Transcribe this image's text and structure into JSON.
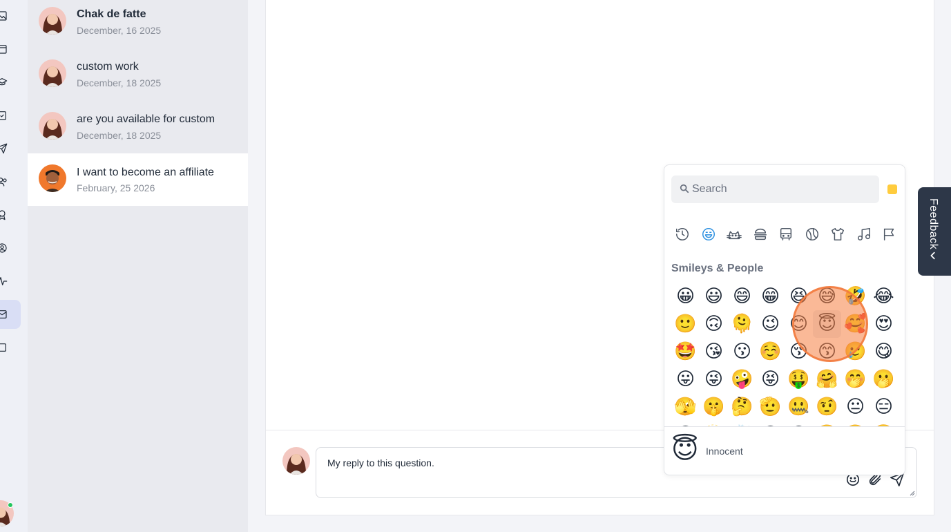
{
  "rail": {
    "icons": [
      "image-icon",
      "calendar-icon",
      "graduation-cap-icon",
      "clipboard-icon",
      "send-icon",
      "users-icon",
      "award-icon",
      "user-circle-icon",
      "activity-icon",
      "inbox-icon",
      "square-icon"
    ],
    "active_icon": "inbox-icon"
  },
  "conversations": [
    {
      "title": "Chak de fatte",
      "date": "December, 16 2025",
      "avatar": "woman-avatar",
      "unread": true,
      "selected": false
    },
    {
      "title": "custom work",
      "date": "December, 18 2025",
      "avatar": "woman-avatar",
      "unread": false,
      "selected": false
    },
    {
      "title": "are you available for custom",
      "date": "December, 18 2025",
      "avatar": "woman-avatar",
      "unread": false,
      "selected": false
    },
    {
      "title": "I want to become an affiliate",
      "date": "February, 25 2026",
      "avatar": "man-avatar",
      "unread": false,
      "selected": true
    }
  ],
  "composer": {
    "text": "My reply to this question.",
    "buttons": [
      "emoji-icon",
      "paperclip-icon",
      "send-icon"
    ]
  },
  "emoji_picker": {
    "search_placeholder": "Search",
    "skin_tone_color": "#ffcc3e",
    "categories": [
      "clock-icon",
      "smiley-icon",
      "cat-icon",
      "burger-icon",
      "bus-icon",
      "ball-icon",
      "shirt-icon",
      "music-icon",
      "flag-icon"
    ],
    "active_category": "smiley-icon",
    "section_title": "Smileys & People",
    "emojis": [
      "😀",
      "😃",
      "😄",
      "😁",
      "😆",
      "😅",
      "🤣",
      "😂",
      "🙂",
      "🙃",
      "🫠",
      "😉",
      "😊",
      "😇",
      "🥰",
      "😍",
      "🤩",
      "😘",
      "😗",
      "☺️",
      "😚",
      "😙",
      "🥲",
      "😋",
      "😛",
      "😜",
      "🤪",
      "😝",
      "🤑",
      "🤗",
      "🤭",
      "🫢",
      "🫣",
      "🤫",
      "🤔",
      "🫡",
      "🤐",
      "🤨",
      "😐",
      "😑",
      "😶",
      "🫥",
      "😶‍🌫️",
      "😏",
      "😒",
      "🙄",
      "😬",
      "😮‍💨"
    ],
    "hovered_emoji": "😇",
    "preview": {
      "emoji": "😇",
      "name": "Innocent"
    }
  },
  "feedback": {
    "label": "Feedback"
  },
  "colors": {
    "accent": "#2d3748",
    "highlight": "#f68042",
    "active_rail": "#d9def5"
  }
}
